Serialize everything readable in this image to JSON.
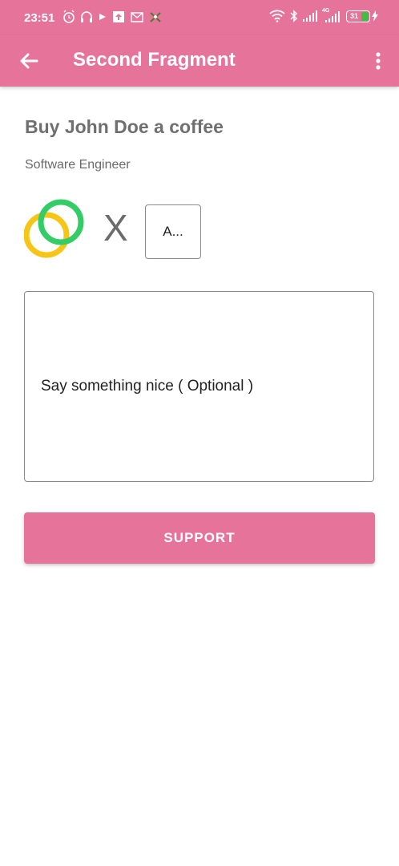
{
  "status_bar": {
    "time": "23:51",
    "left_icons": [
      "alarm-icon",
      "headset-icon",
      "play-icon",
      "upload-icon",
      "gmail-icon",
      "app-icon"
    ],
    "right_icons": [
      "wifi-icon",
      "bluetooth-icon",
      "signal-icon",
      "signal-4g-icon",
      "battery-icon"
    ],
    "network": "4G",
    "battery_level": "31"
  },
  "app_bar": {
    "title": "Second Fragment",
    "back_icon": "arrow-left-icon",
    "menu_icon": "more-vert-icon"
  },
  "content": {
    "heading": "Buy John Doe a coffee",
    "subtitle": "Software Engineer",
    "multiplier": "X",
    "amount_value": "A...",
    "message_placeholder": "Say something nice ( Optional )",
    "support_button": "SUPPORT"
  },
  "colors": {
    "primary": "#e67399",
    "logo_green": "#33cc66",
    "logo_yellow": "#f5c518"
  }
}
